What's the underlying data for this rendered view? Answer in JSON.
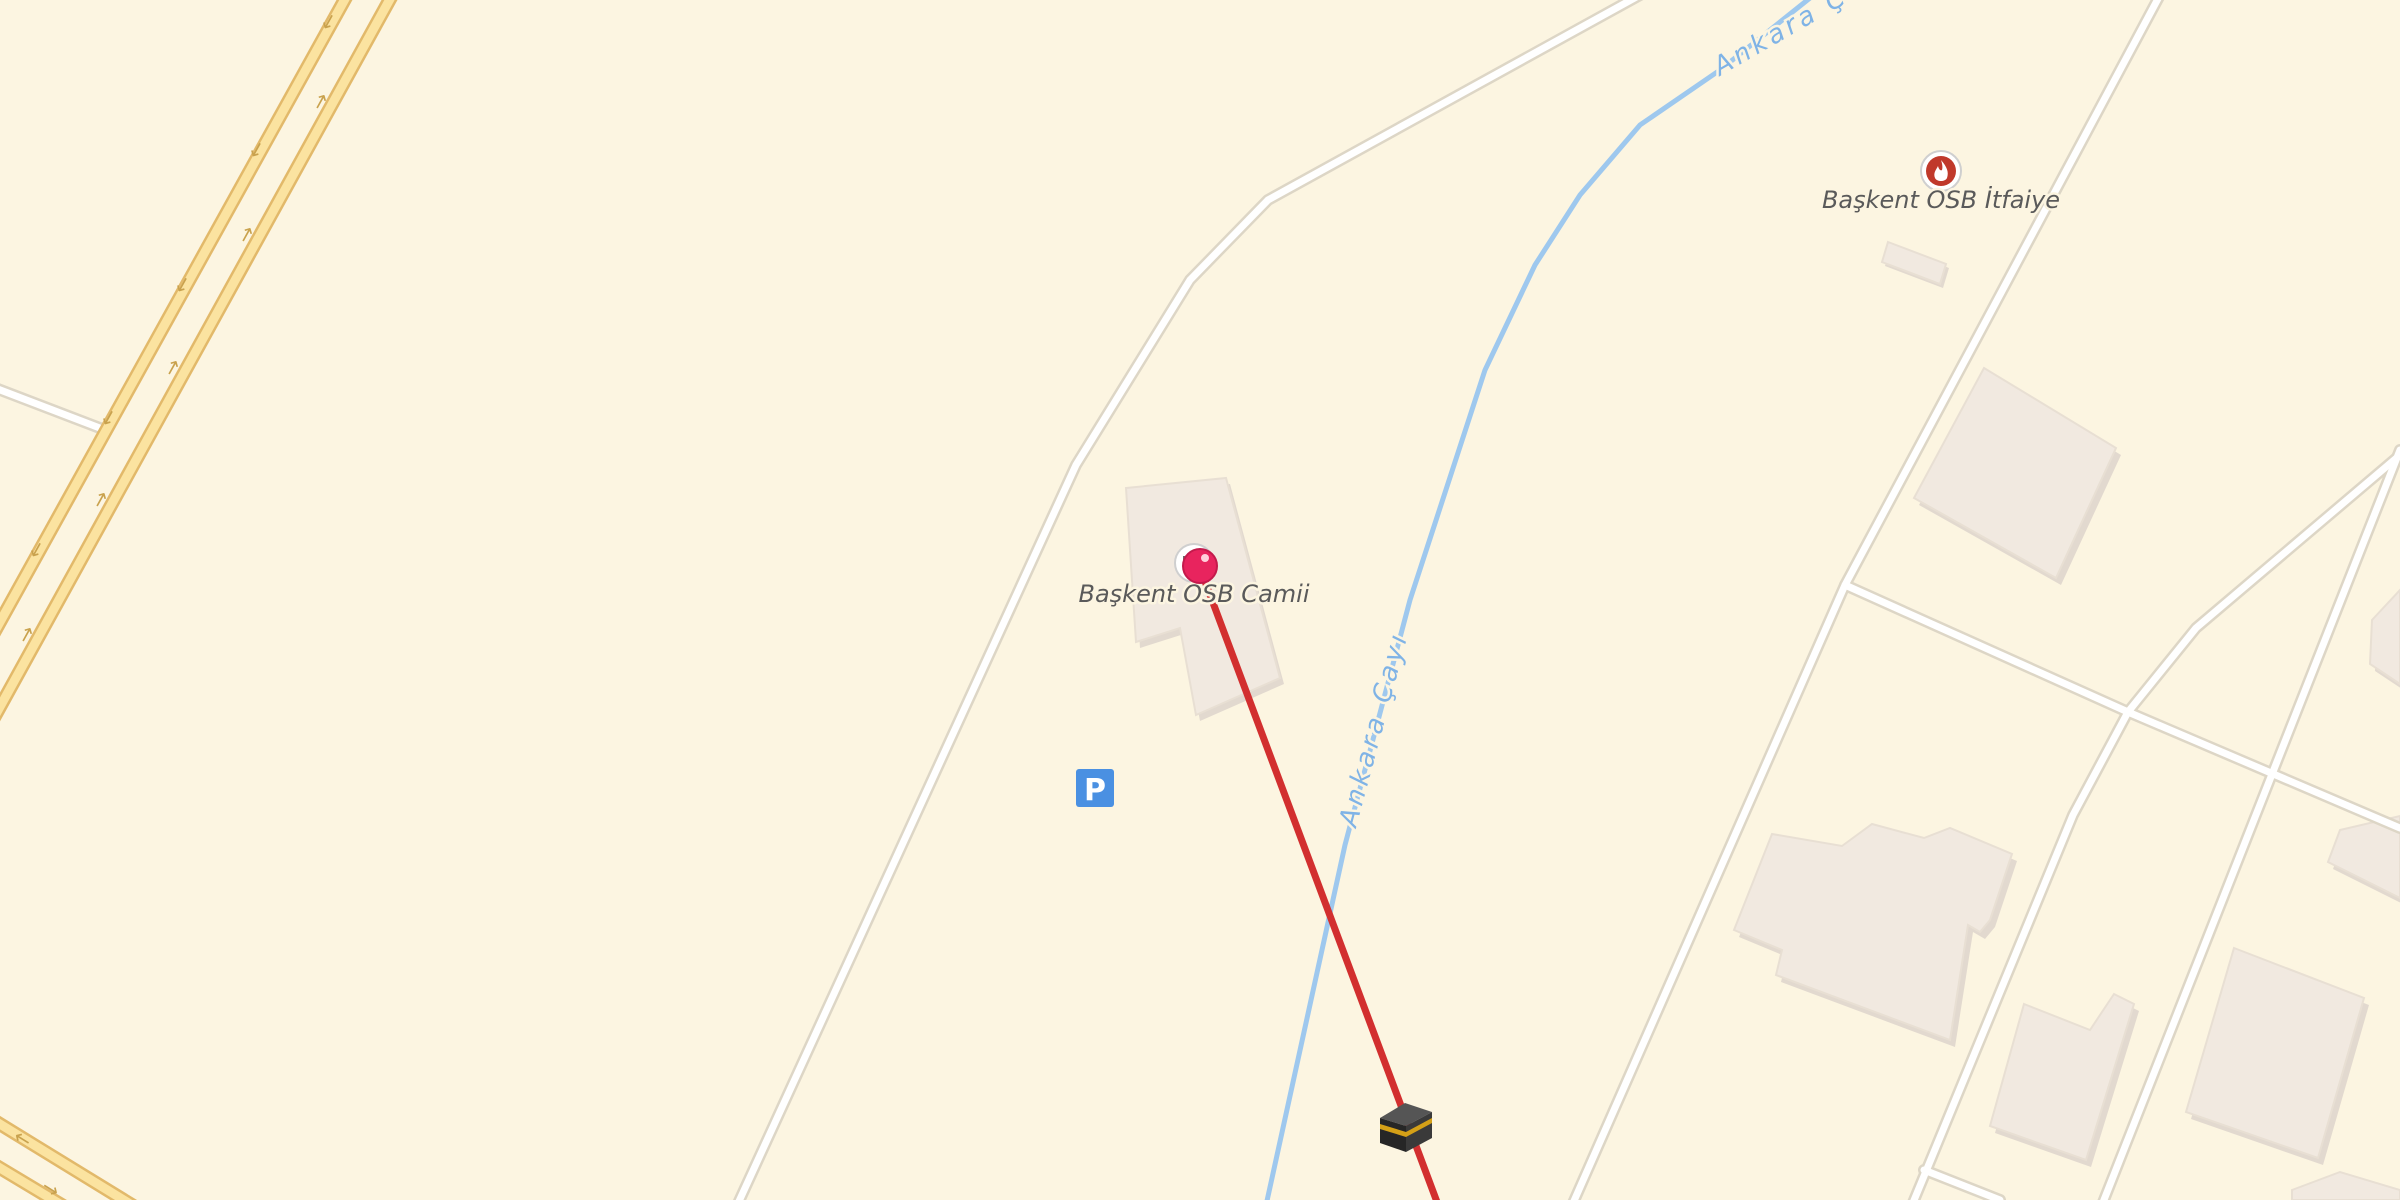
{
  "map": {
    "pois": [
      {
        "id": "camii",
        "label": "Başkent OSB Camii",
        "icon": "mosque-icon"
      },
      {
        "id": "itfaiye",
        "label": "Başkent OSB İtfaiye",
        "icon": "fire-station-icon"
      },
      {
        "id": "parking",
        "label": "P",
        "icon": "parking-icon"
      }
    ],
    "river": {
      "labels": [
        "Ankara Çayı",
        "Ankara Ç"
      ]
    },
    "markers": {
      "origin": {
        "icon": "location-pin-icon"
      },
      "destination": {
        "icon": "kaaba-icon"
      }
    },
    "route": {
      "kind": "qibla-direction-line",
      "color": "#d22f2f"
    },
    "colors": {
      "land": "#fcf5e1",
      "road": "#ffffff",
      "road_casing": "#ddd6c6",
      "highway": "#fbe3a0",
      "highway_casing": "#e2b96a",
      "building": "#f1e9e0",
      "river": "#9ec8ee",
      "parking": "#4a90e2",
      "fire": "#c0392b",
      "pin": "#e8245e"
    }
  }
}
